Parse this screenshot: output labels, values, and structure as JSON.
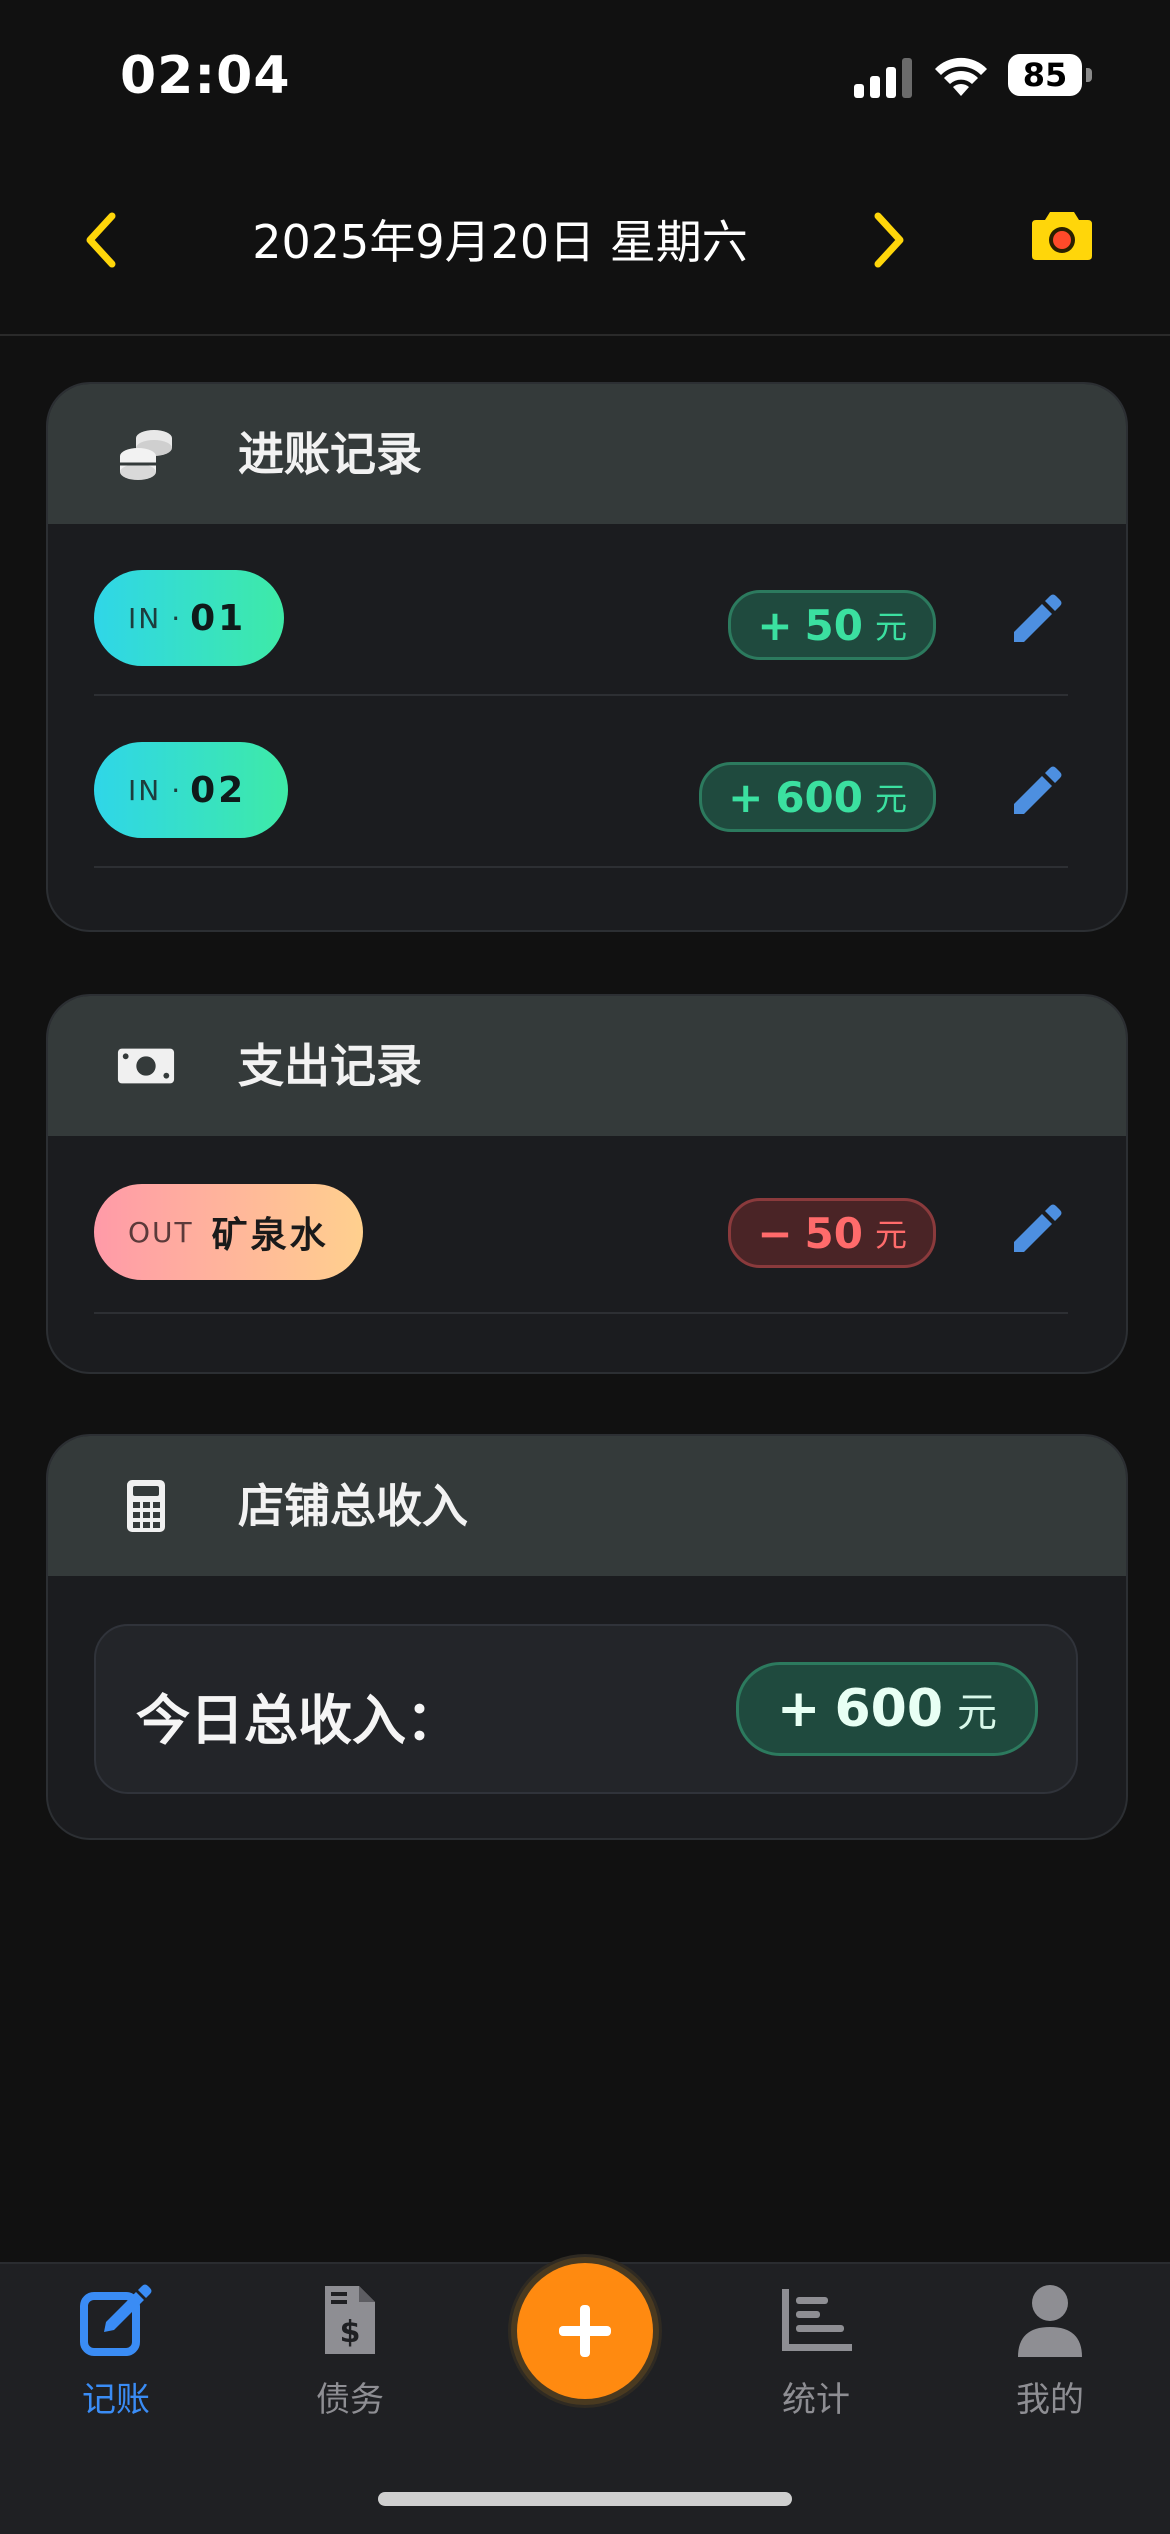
{
  "status_bar": {
    "time": "02:04",
    "battery": "85"
  },
  "header": {
    "date": "2025年9月20日 星期六"
  },
  "income": {
    "title": "进账记录",
    "rows": [
      {
        "prefix": "IN",
        "dot": "·",
        "name": "01",
        "sign": "+",
        "amount": "50",
        "unit": "元"
      },
      {
        "prefix": "IN",
        "dot": "·",
        "name": "02",
        "sign": "+",
        "amount": "600",
        "unit": "元"
      }
    ]
  },
  "expense": {
    "title": "支出记录",
    "rows": [
      {
        "prefix": "OUT",
        "name": "矿泉水",
        "sign": "−",
        "amount": "50",
        "unit": "元"
      }
    ]
  },
  "total": {
    "title": "店铺总收入",
    "label": "今日总收入：",
    "sign": "+",
    "amount": "600",
    "unit": "元"
  },
  "tabs": [
    {
      "label": "记账",
      "icon": "edit-square-icon",
      "active": true
    },
    {
      "label": "债务",
      "icon": "invoice-dollar-icon"
    },
    {
      "label": "",
      "icon": "plus-icon"
    },
    {
      "label": "统计",
      "icon": "bar-chart-icon"
    },
    {
      "label": "我的",
      "icon": "user-icon"
    }
  ],
  "colors": {
    "accent_yellow": "#FFD60A",
    "tab_active": "#3A8CF5",
    "fab": "#FF8A10",
    "income_green": "#3BE0A0",
    "expense_red": "#FF6B6B"
  }
}
